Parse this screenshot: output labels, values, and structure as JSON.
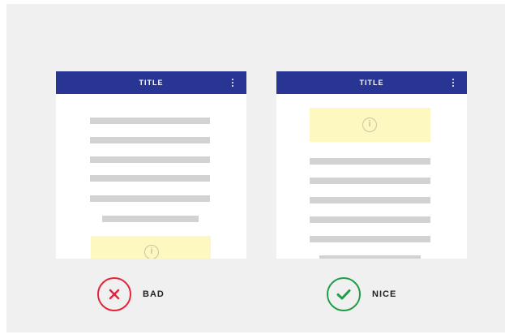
{
  "examples": {
    "bad": {
      "app_title": "TITLE",
      "verdict_label": "BAD",
      "verdict_icon": "x-circle-icon",
      "verdict_color": "#e3243b"
    },
    "nice": {
      "app_title": "TITLE",
      "verdict_label": "NICE",
      "verdict_icon": "check-circle-icon",
      "verdict_color": "#1f9e48"
    }
  },
  "colors": {
    "app_bar": "#283593",
    "background": "#f0f0f0",
    "notice": "#fdf8bf",
    "placeholder_line": "#d2d2d2"
  },
  "info_glyph": "i"
}
